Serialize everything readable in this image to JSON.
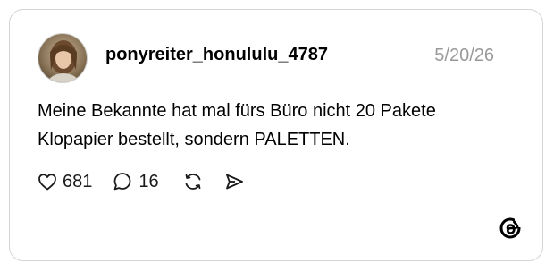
{
  "post": {
    "username": "ponyreiter_honululu_4787",
    "date": "5/20/26",
    "text_lines": [
      "Meine Bekannte hat mal fürs Büro nicht 20 Pakete",
      "Klopapier bestellt, sondern PALETTEN."
    ],
    "likes": "681",
    "replies": "16"
  },
  "icons": {
    "like": "heart-icon",
    "reply": "speech-bubble-icon",
    "repost": "repost-arrows-icon",
    "share": "send-icon",
    "brand": "threads-logo-icon"
  },
  "colors": {
    "text": "#000000",
    "muted": "#999999",
    "border": "#d4d4d4"
  }
}
